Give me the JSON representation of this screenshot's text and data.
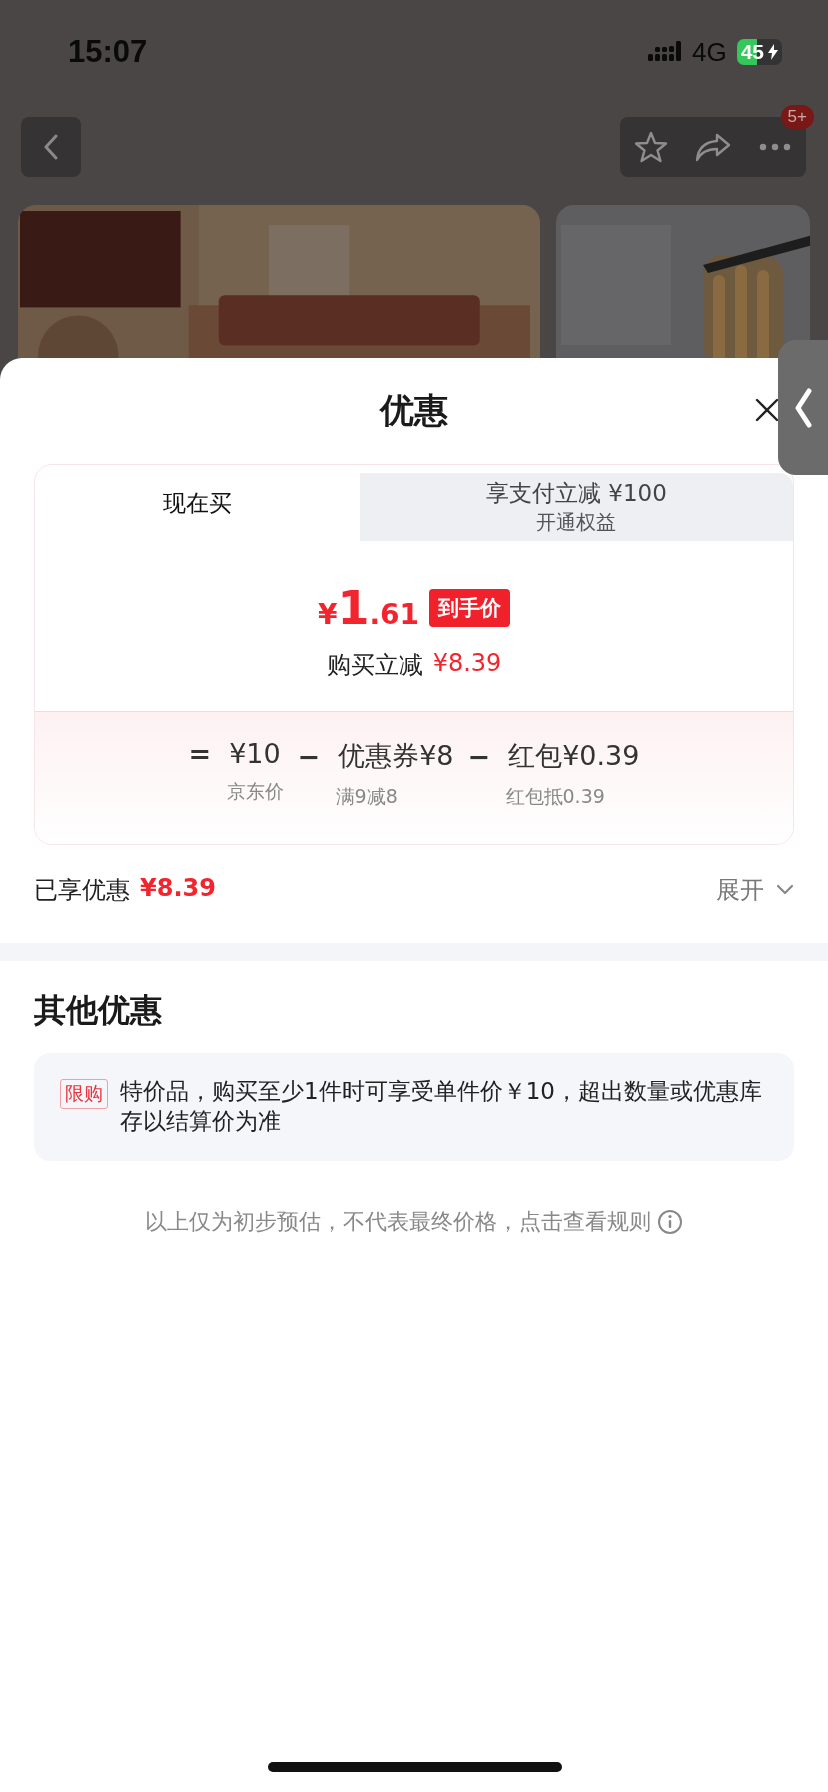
{
  "status_bar": {
    "time": "15:07",
    "network": "4G",
    "battery": "45"
  },
  "nav": {
    "badge": "5+"
  },
  "sheet": {
    "title": "优惠",
    "tabs": [
      {
        "label": "现在买",
        "selected": true
      },
      {
        "label": "享支付立减 ¥100",
        "sublabel": "开通权益",
        "selected": false
      }
    ],
    "price": {
      "currency": "¥",
      "integer": "1",
      "decimal": ".61",
      "tag": "到手价",
      "saving_label": "购买立减",
      "saving_amount": "¥8.39"
    },
    "breakdown": [
      {
        "operator": "=",
        "value": "¥10",
        "note": "京东价"
      },
      {
        "operator": "−",
        "value": "优惠券¥8",
        "note": "满9减8"
      },
      {
        "operator": "−",
        "value": "红包¥0.39",
        "note": "红包抵0.39"
      }
    ],
    "summary": {
      "label": "已享优惠",
      "amount": "¥8.39",
      "expand": "展开"
    },
    "other": {
      "title": "其他优惠",
      "items": [
        {
          "tag": "限购",
          "text": "特价品，购买至少1件时可享受单件价￥10，超出数量或优惠库存以结算价为准"
        }
      ]
    },
    "footnote": "以上仅为初步预估，不代表最终价格，点击查看规则"
  }
}
